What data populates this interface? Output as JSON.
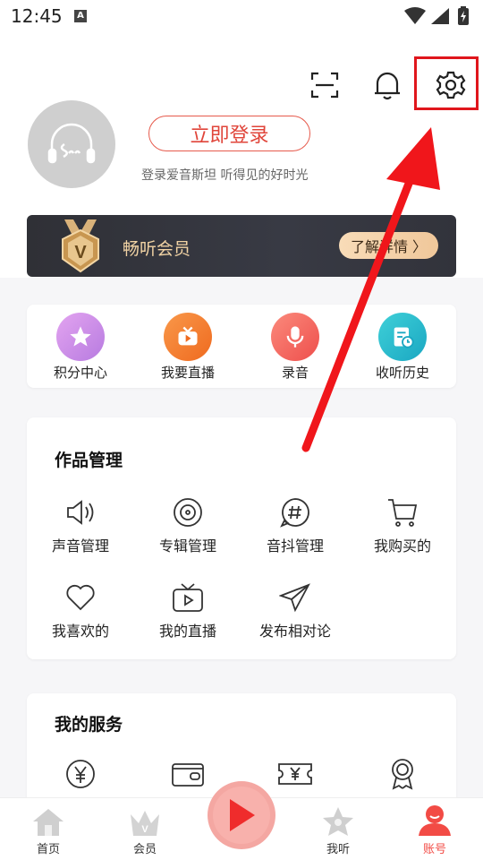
{
  "status_bar": {
    "time": "12:45",
    "notification_letter": "A"
  },
  "header": {
    "login_label": "立即登录",
    "login_subtitle": "登录爱音斯坦 听得见的好时光",
    "icons": [
      "scan-icon",
      "bell-icon",
      "gear-icon"
    ]
  },
  "vip": {
    "title": "畅听会员",
    "more_label": "了解详情 〉"
  },
  "quick_actions": [
    {
      "label": "积分中心",
      "icon": "star-icon",
      "color": "#c98be8"
    },
    {
      "label": "我要直播",
      "icon": "live-tv-icon",
      "color": "#f27a2b"
    },
    {
      "label": "录音",
      "icon": "microphone-icon",
      "color": "#f15f5a"
    },
    {
      "label": "收听历史",
      "icon": "history-icon",
      "color": "#2bbfcf"
    }
  ],
  "works": {
    "title": "作品管理",
    "items": [
      {
        "label": "声音管理",
        "icon": "speaker-icon"
      },
      {
        "label": "专辑管理",
        "icon": "disc-icon"
      },
      {
        "label": "音抖管理",
        "icon": "hashtag-icon"
      },
      {
        "label": "我购买的",
        "icon": "cart-icon"
      },
      {
        "label": "我喜欢的",
        "icon": "heart-icon"
      },
      {
        "label": "我的直播",
        "icon": "tv-icon"
      },
      {
        "label": "发布相对论",
        "icon": "paper-plane-icon"
      }
    ]
  },
  "services": {
    "title": "我的服务",
    "icons": [
      "coin-yen-icon",
      "wallet-icon",
      "ticket-yen-icon",
      "medal-icon"
    ]
  },
  "tabs": [
    {
      "label": "首页",
      "icon": "home-icon"
    },
    {
      "label": "会员",
      "icon": "crown-icon"
    },
    {
      "label": "我听",
      "icon": "star-icon"
    },
    {
      "label": "账号",
      "icon": "user-icon",
      "active": true
    }
  ],
  "colors": {
    "accent": "#e84a3c",
    "highlight": "#e0161c",
    "tab_active": "#f24b45"
  }
}
